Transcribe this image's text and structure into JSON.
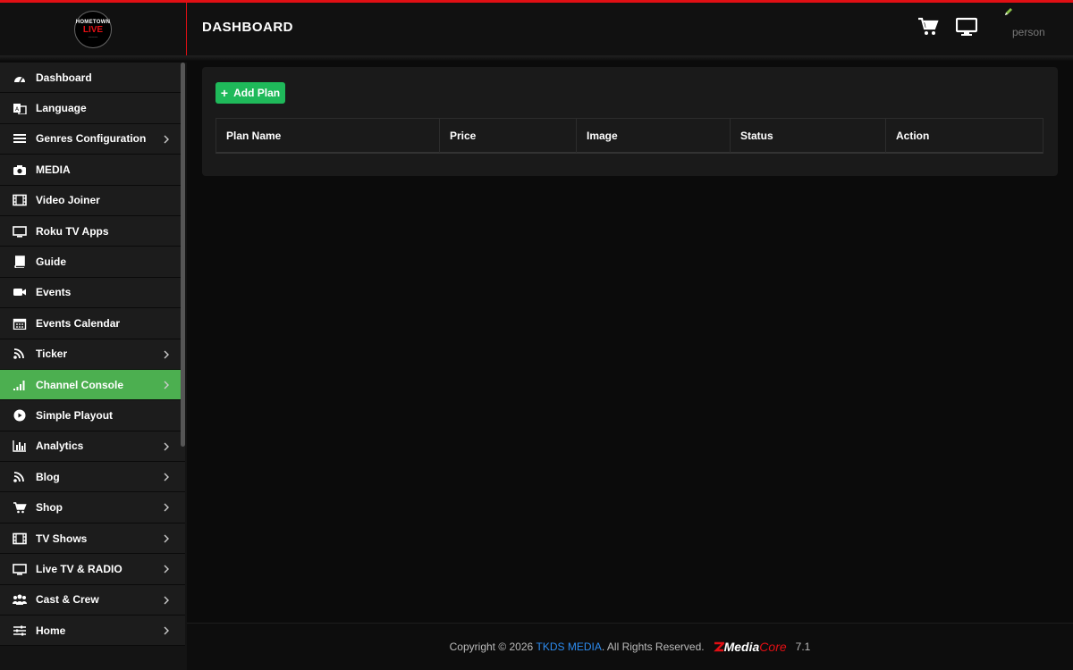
{
  "header": {
    "page_title": "DASHBOARD",
    "logo_line1": "HOMETOWN",
    "logo_line2": "LIVE",
    "user_label": "person"
  },
  "sidebar": {
    "items": [
      {
        "label": "Dashboard",
        "icon": "dashboard-icon",
        "chevron": false,
        "active": false
      },
      {
        "label": "Language",
        "icon": "language-icon",
        "chevron": false,
        "active": false
      },
      {
        "label": "Genres Configuration",
        "icon": "list-icon",
        "chevron": true,
        "active": false
      },
      {
        "label": "MEDIA",
        "icon": "camera-icon",
        "chevron": false,
        "active": false
      },
      {
        "label": "Video Joiner",
        "icon": "film-icon",
        "chevron": false,
        "active": false
      },
      {
        "label": "Roku TV Apps",
        "icon": "monitor-icon",
        "chevron": false,
        "active": false
      },
      {
        "label": "Guide",
        "icon": "book-icon",
        "chevron": false,
        "active": false
      },
      {
        "label": "Events",
        "icon": "video-camera-icon",
        "chevron": false,
        "active": false
      },
      {
        "label": "Events Calendar",
        "icon": "calendar-icon",
        "chevron": false,
        "active": false
      },
      {
        "label": "Ticker",
        "icon": "rss-icon",
        "chevron": true,
        "active": false
      },
      {
        "label": "Channel Console",
        "icon": "signal-icon",
        "chevron": true,
        "active": true
      },
      {
        "label": "Simple Playout",
        "icon": "play-circle-icon",
        "chevron": false,
        "active": false
      },
      {
        "label": "Analytics",
        "icon": "bar-chart-icon",
        "chevron": true,
        "active": false
      },
      {
        "label": "Blog",
        "icon": "rss-icon",
        "chevron": true,
        "active": false
      },
      {
        "label": "Shop",
        "icon": "cart-icon",
        "chevron": true,
        "active": false
      },
      {
        "label": "TV Shows",
        "icon": "film-icon",
        "chevron": true,
        "active": false
      },
      {
        "label": "Live TV & RADIO",
        "icon": "monitor-icon",
        "chevron": true,
        "active": false
      },
      {
        "label": "Cast & Crew",
        "icon": "users-icon",
        "chevron": true,
        "active": false
      },
      {
        "label": "Home",
        "icon": "sliders-icon",
        "chevron": true,
        "active": false
      }
    ]
  },
  "main": {
    "add_button_label": "Add Plan",
    "add_button_icon": "plus-icon",
    "table": {
      "columns": [
        "Plan Name",
        "Price",
        "Image",
        "Status",
        "Action"
      ]
    }
  },
  "footer": {
    "copyright": "Copyright © 2026",
    "company": "TKDS MEDIA",
    "rights": ". All Rights Reserved.",
    "brand_bold": "Media",
    "brand_light": "Core",
    "version": "7.1"
  },
  "colors": {
    "accent_red": "#e10f14",
    "active_green": "#4caf50",
    "button_green": "#1fb95a",
    "link_blue": "#2d8cf0"
  }
}
